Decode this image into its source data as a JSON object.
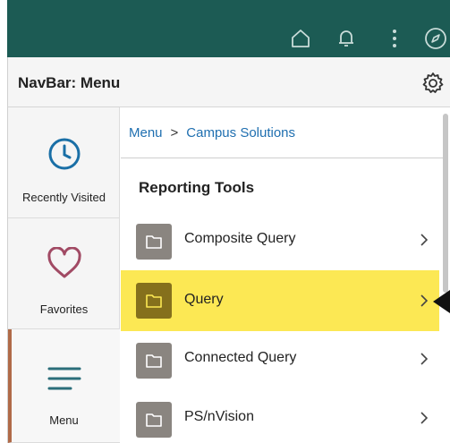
{
  "topbar": {
    "icons": [
      "home-icon",
      "bell-icon",
      "more-vertical-icon",
      "compass-icon"
    ]
  },
  "navbar": {
    "title": "NavBar: Menu",
    "settings_icon": "gear-icon"
  },
  "leftnav": {
    "items": [
      {
        "label": "Recently Visited",
        "icon": "clock-icon"
      },
      {
        "label": "Favorites",
        "icon": "heart-icon"
      },
      {
        "label": "Menu",
        "icon": "menu-lines-icon"
      }
    ],
    "active_item": "Menu",
    "active_color": "#b06a48"
  },
  "breadcrumb": {
    "items": [
      "Menu",
      "Campus Solutions"
    ],
    "separator": ">"
  },
  "section": {
    "title": "Reporting Tools"
  },
  "menu_rows": [
    {
      "label": "Composite Query",
      "icon": "folder-icon",
      "chevron": ">"
    },
    {
      "label": "Query",
      "icon": "folder-icon",
      "chevron": ">",
      "highlighted": true
    },
    {
      "label": "Connected Query",
      "icon": "folder-icon",
      "chevron": ">"
    },
    {
      "label": "PS/nVision",
      "icon": "folder-icon",
      "chevron": ">"
    }
  ],
  "colors": {
    "header_bg": "#1c5b54",
    "highlight": "#fce854",
    "link": "#1f6fb0",
    "folder": "#8a8580"
  }
}
